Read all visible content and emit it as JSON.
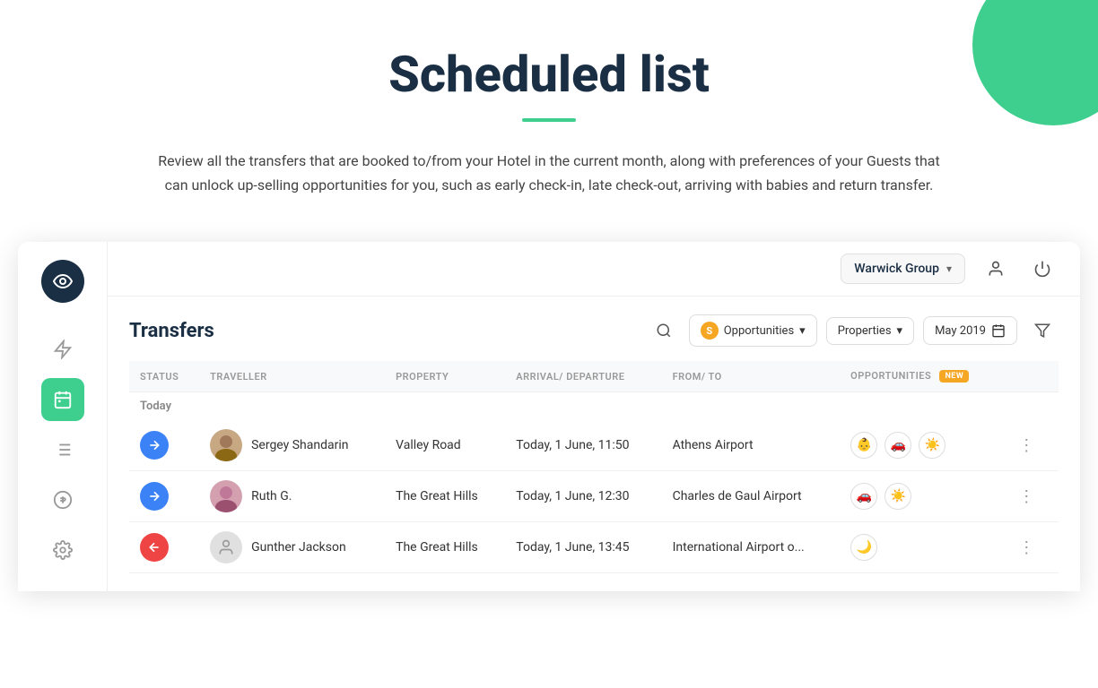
{
  "page": {
    "title": "Scheduled list",
    "description": "Review all the transfers that are booked to/from your Hotel in the current month, along with preferences of your Guests that can unlock up-selling opportunities for you, such as early check-in, late check-out, arriving with babies and return transfer."
  },
  "sidebar": {
    "logo_icon": "eye-icon",
    "items": [
      {
        "id": "bolt",
        "label": "Flash",
        "active": false
      },
      {
        "id": "schedule",
        "label": "Scheduled",
        "active": true
      },
      {
        "id": "list",
        "label": "List",
        "active": false
      },
      {
        "id": "dollar",
        "label": "Dollar",
        "active": false
      },
      {
        "id": "settings",
        "label": "Settings",
        "active": false
      }
    ]
  },
  "topbar": {
    "hotel": "Warwick Group",
    "user_icon": "user-icon",
    "power_icon": "power-icon"
  },
  "transfers": {
    "title": "Transfers",
    "filter_opportunities": "Opportunities",
    "filter_properties": "Properties",
    "filter_date": "May 2019",
    "new_badge": "New",
    "section_today": "Today",
    "columns": {
      "status": "Status",
      "traveller": "Traveller",
      "property": "Property",
      "arrival_departure": "Arrival/ Departure",
      "from_to": "From/ To",
      "opportunities": "Opportunities"
    },
    "rows": [
      {
        "status_color": "blue",
        "traveller_name": "Sergey Shandarin",
        "property": "Valley Road",
        "arrival_departure": "Today, 1 June, 11:50",
        "from_to": "Athens Airport",
        "opportunities": [
          "baby-icon",
          "car-icon",
          "sun-icon"
        ]
      },
      {
        "status_color": "blue",
        "traveller_name": "Ruth G.",
        "property": "The Great Hills",
        "arrival_departure": "Today, 1 June, 12:30",
        "from_to": "Charles de Gaul Airport",
        "opportunities": [
          "car-icon",
          "sun-icon"
        ]
      },
      {
        "status_color": "red",
        "traveller_name": "Gunther Jackson",
        "property": "The Great Hills",
        "arrival_departure": "Today, 1 June, 13:45",
        "from_to": "International Airport o...",
        "opportunities": [
          "moon-icon"
        ]
      }
    ]
  }
}
